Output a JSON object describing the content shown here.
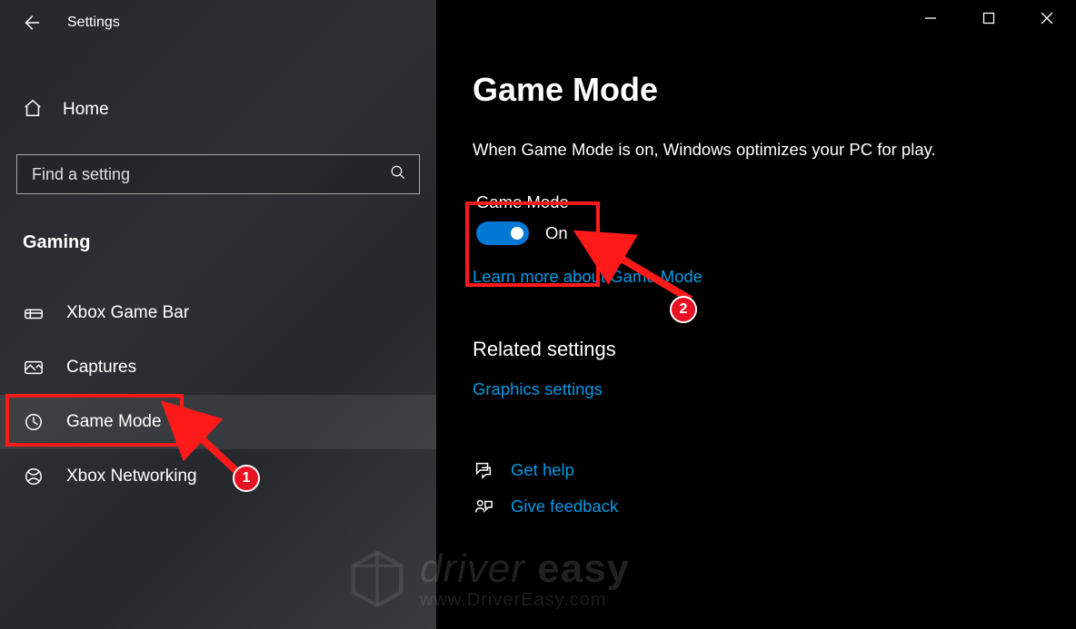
{
  "window": {
    "title": "Settings"
  },
  "sidebar": {
    "home_label": "Home",
    "search_placeholder": "Find a setting",
    "section": "Gaming",
    "items": [
      {
        "label": "Xbox Game Bar",
        "icon": "xbox-gamebar-icon",
        "selected": false
      },
      {
        "label": "Captures",
        "icon": "captures-icon",
        "selected": false
      },
      {
        "label": "Game Mode",
        "icon": "gamemode-icon",
        "selected": true
      },
      {
        "label": "Xbox Networking",
        "icon": "xbox-network-icon",
        "selected": false
      }
    ]
  },
  "main": {
    "title": "Game Mode",
    "description": "When Game Mode is on, Windows optimizes your PC for play.",
    "toggle": {
      "label": "Game Mode",
      "state_text": "On",
      "on": true
    },
    "learn_link": "Learn more about Game Mode",
    "related_title": "Related settings",
    "related_link": "Graphics settings",
    "help": {
      "get_help": "Get help",
      "give_feedback": "Give feedback"
    }
  },
  "annotations": {
    "badge1": "1",
    "badge2": "2"
  },
  "watermark": {
    "line1_a": "driver",
    "line1_b": "easy",
    "line2": "www.DriverEasy.com"
  }
}
